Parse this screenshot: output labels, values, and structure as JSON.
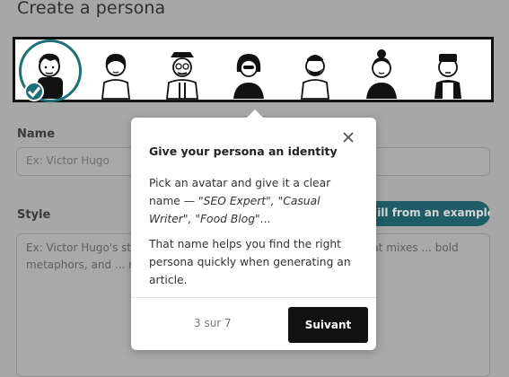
{
  "page": {
    "title": "Create a persona"
  },
  "avatars": {
    "selected_index": 0,
    "items": [
      {
        "name": "avatar-1"
      },
      {
        "name": "avatar-2"
      },
      {
        "name": "avatar-3"
      },
      {
        "name": "avatar-4"
      },
      {
        "name": "avatar-5"
      },
      {
        "name": "avatar-6"
      },
      {
        "name": "avatar-7"
      }
    ]
  },
  "form": {
    "name_label": "Name",
    "name_placeholder": "Ex: Victor Hugo",
    "style_label": "Style",
    "fill_button": "Fill from an example",
    "style_placeholder": "Ex: Victor Hugo's style ... is characterized by powerful writing that mixes ... bold metaphors, and ... rich vocabulary ... prophetic dimension"
  },
  "popover": {
    "title": "Give your persona an identity",
    "body_line1_pre": "Pick an avatar and give it a clear name — ",
    "body_line1_examples": "\"SEO Expert\", \"Casual Writer\", \"Food Blog\"",
    "body_line1_post": "...",
    "body_line2": "That name helps you find the right persona quickly when generating an article.",
    "step": "3 sur 7",
    "next_button": "Suivant"
  },
  "colors": {
    "accent": "#1f6f7a",
    "button": "#111111"
  }
}
